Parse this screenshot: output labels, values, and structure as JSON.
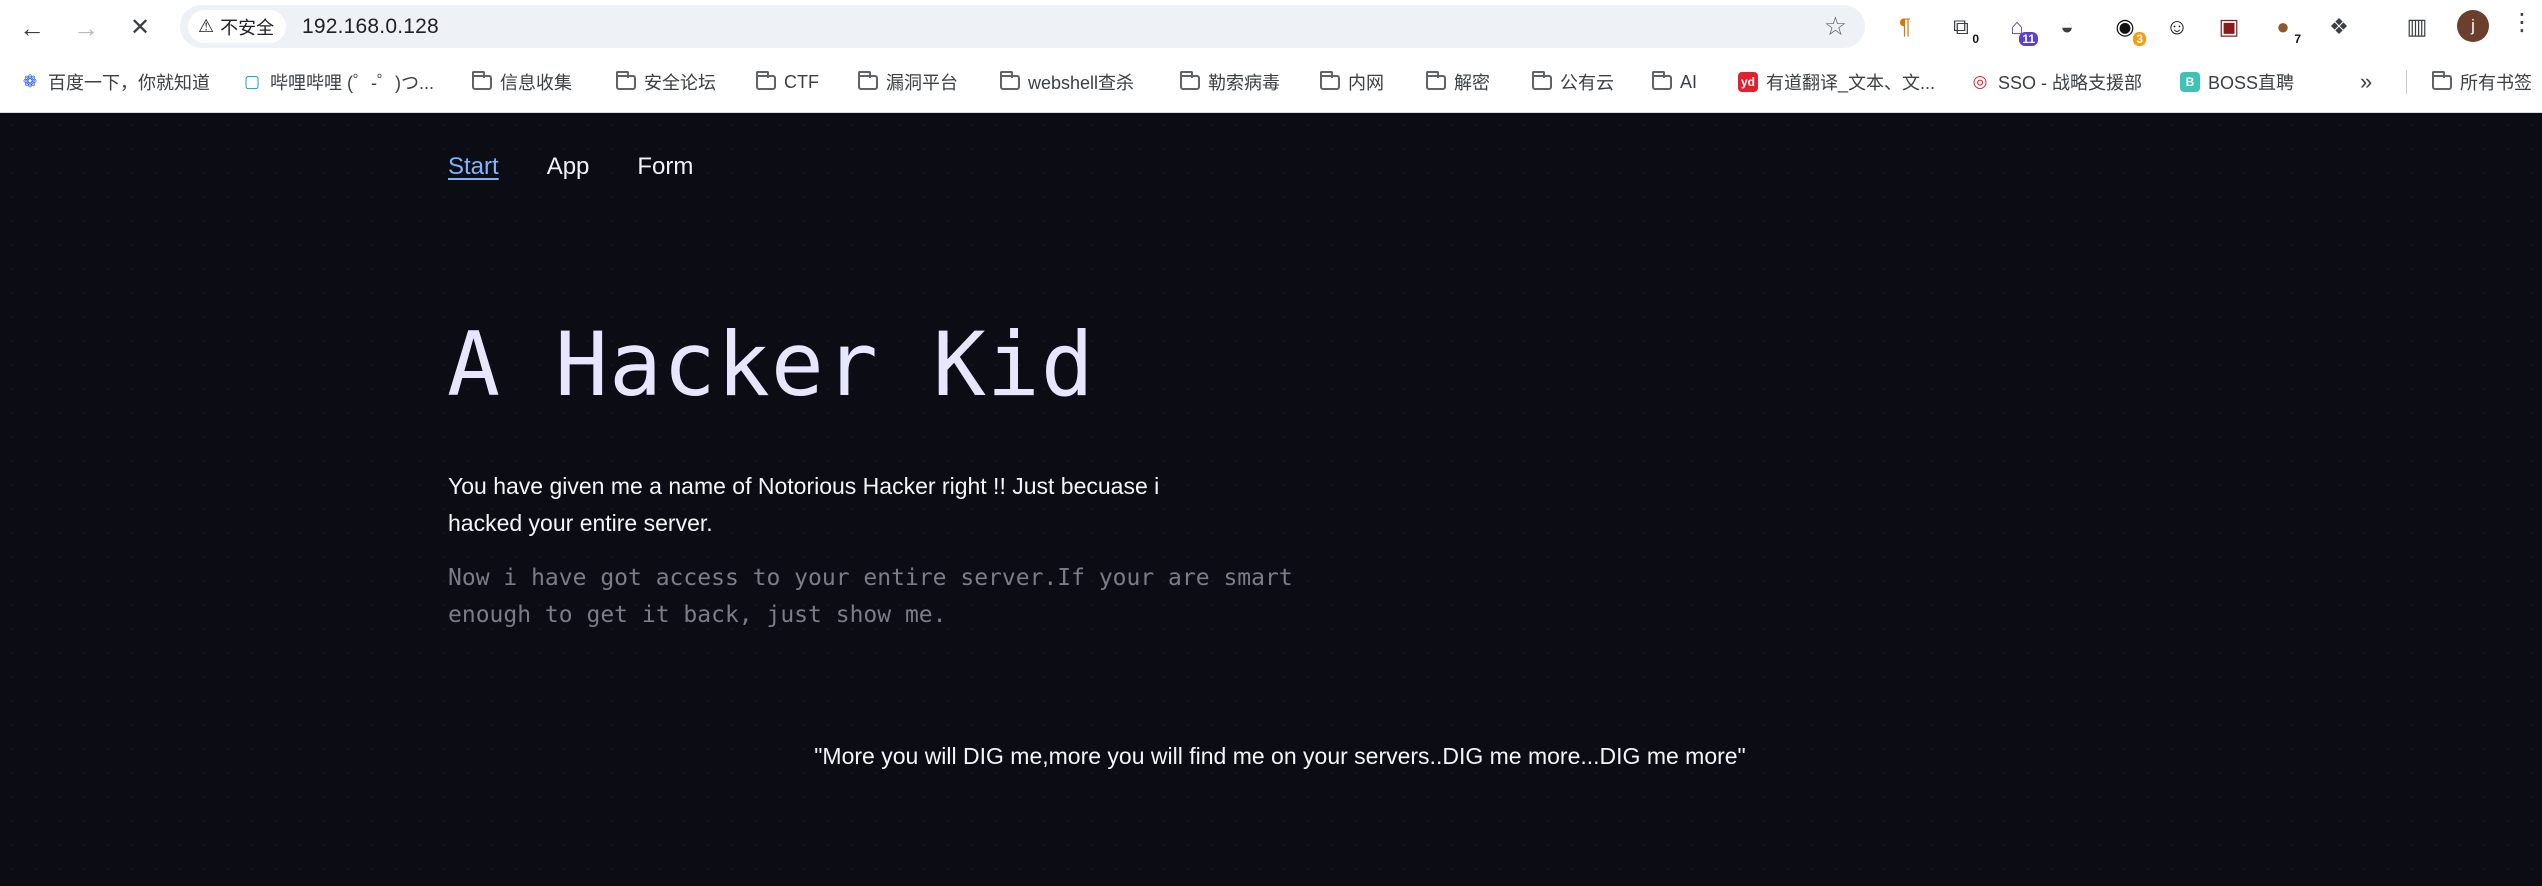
{
  "browser": {
    "security_label": "不安全",
    "url": "192.168.0.128",
    "extensions": [
      {
        "name": "pilcrow-icon",
        "badge": ""
      },
      {
        "name": "screenshot-icon",
        "badge": "0"
      },
      {
        "name": "hackbar-icon",
        "badge": "11"
      },
      {
        "name": "hat-icon",
        "badge": ""
      },
      {
        "name": "wappalyzer-icon",
        "badge": "3"
      },
      {
        "name": "spy-icon",
        "badge": ""
      },
      {
        "name": "findsomething-icon",
        "badge": ""
      },
      {
        "name": "cookie-icon",
        "badge": "7"
      },
      {
        "name": "puzzle-icon",
        "badge": ""
      },
      {
        "name": "side-panel-icon",
        "badge": ""
      }
    ],
    "profile_initial": "j",
    "bookmarks": [
      {
        "label": "百度一下，你就知道",
        "icon": "baidu-icon"
      },
      {
        "label": "哔哩哔哩 (゜-゜)つ...",
        "icon": "bilibili-icon"
      },
      {
        "label": "信息收集",
        "icon": "folder-icon"
      },
      {
        "label": "安全论坛",
        "icon": "folder-icon"
      },
      {
        "label": "CTF",
        "icon": "folder-icon"
      },
      {
        "label": "漏洞平台",
        "icon": "folder-icon"
      },
      {
        "label": "webshell查杀",
        "icon": "folder-icon"
      },
      {
        "label": "勒索病毒",
        "icon": "folder-icon"
      },
      {
        "label": "内网",
        "icon": "folder-icon"
      },
      {
        "label": "解密",
        "icon": "folder-icon"
      },
      {
        "label": "公有云",
        "icon": "folder-icon"
      },
      {
        "label": "AI",
        "icon": "folder-icon"
      },
      {
        "label": "有道翻译_文本、文...",
        "icon": "youdao-icon"
      },
      {
        "label": "SSO - 战略支援部",
        "icon": "sso-icon"
      },
      {
        "label": "BOSS直聘",
        "icon": "boss-icon"
      }
    ],
    "all_bookmarks_label": "所有书签"
  },
  "site": {
    "nav": [
      {
        "label": "Start",
        "active": true
      },
      {
        "label": "App",
        "active": false
      },
      {
        "label": "Form",
        "active": false
      }
    ],
    "title": "A Hacker Kid",
    "lead": "You have given me a name of Notorious Hacker right !! Just becuase i hacked your entire server.",
    "sub": "Now i have got access to your entire server.If your are smart enough to get it back, just show me.",
    "quote": "\"More you will DIG me,more you will find me on your servers..DIG me more...DIG me more\""
  },
  "colors": {
    "page_bg": "#0b0c14",
    "active_link": "#7fb4ff",
    "title": "#e7e6ff",
    "muted_text": "#7b7c88"
  }
}
